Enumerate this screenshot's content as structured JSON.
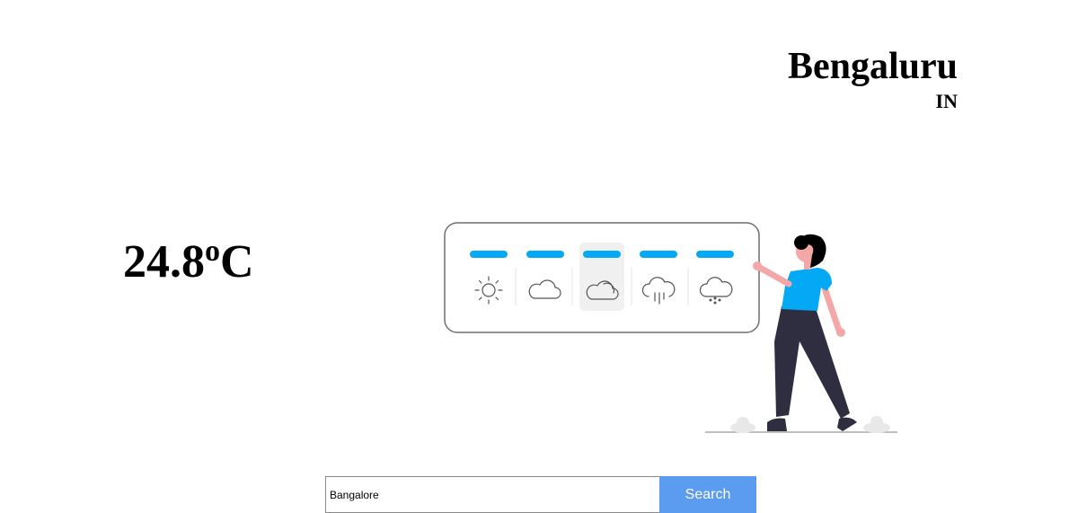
{
  "location": {
    "city": "Bengaluru",
    "country": "IN"
  },
  "weather": {
    "temperature": "24.8",
    "degree_symbol": "o",
    "unit": "C"
  },
  "search": {
    "value": "Bangalore",
    "button_label": "Search"
  },
  "colors": {
    "accent_blue": "#03a9f4",
    "button_blue": "#5b9bf0",
    "figure_shirt": "#03a9f4",
    "figure_pants": "#2f2e41",
    "figure_skin": "#f4a7a7"
  },
  "illustration": {
    "icons": [
      "sun-icon",
      "cloud-icon",
      "cloud-sun-icon",
      "rain-cloud-icon",
      "snow-cloud-icon"
    ],
    "selected_index": 2
  }
}
